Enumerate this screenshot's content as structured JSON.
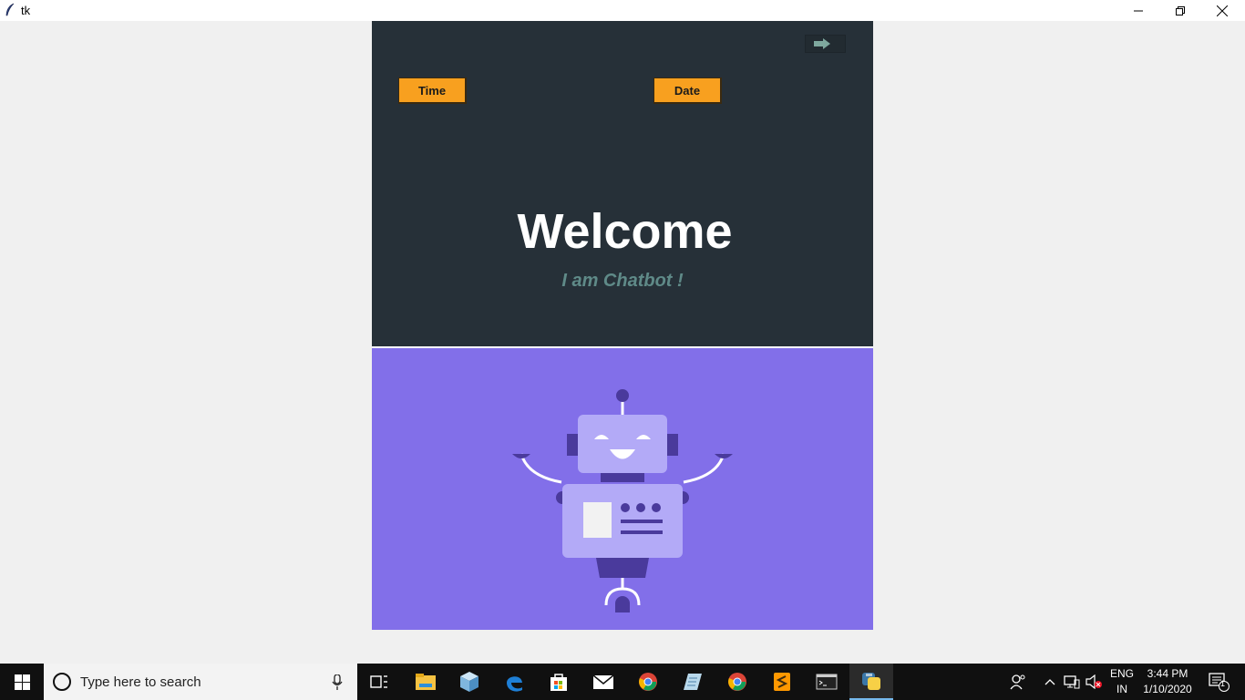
{
  "window": {
    "title": "tk"
  },
  "buttons": {
    "time": "Time",
    "date": "Date"
  },
  "hero": {
    "welcome": "Welcome",
    "subtitle": "I am Chatbot !"
  },
  "colors": {
    "top_panel": "#263038",
    "bottom_panel": "#826fe9",
    "accent_button": "#f8a01f",
    "subtitle": "#5f8a88"
  },
  "taskbar": {
    "search_placeholder": "Type here to search",
    "apps": [
      "task-view",
      "file-explorer",
      "3d-box",
      "edge",
      "store",
      "mail",
      "chrome",
      "notepad",
      "chrome",
      "sublime-text",
      "terminal",
      "python"
    ],
    "language_top": "ENG",
    "language_bottom": "IN",
    "time": "3:44 PM",
    "date": "1/10/2020",
    "notification_count": "1"
  }
}
